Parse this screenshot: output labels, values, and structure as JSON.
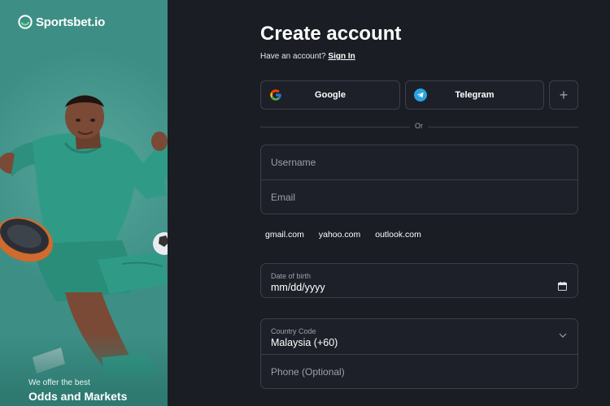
{
  "brand": {
    "name": "Sportsbet.io"
  },
  "promo": {
    "tagline_small": "We offer the best",
    "tagline_big": "Odds and Markets"
  },
  "form": {
    "title": "Create account",
    "have_account_text": "Have an account?",
    "sign_in_link": "Sign In",
    "social": {
      "google_label": "Google",
      "telegram_label": "Telegram",
      "more_label": "+"
    },
    "divider_text": "Or",
    "username_placeholder": "Username",
    "email_placeholder": "Email",
    "email_domains": [
      "gmail.com",
      "yahoo.com",
      "outlook.com"
    ],
    "dob": {
      "label": "Date of birth",
      "value": "mm/dd/yyyy",
      "icon": "calendar-icon"
    },
    "country": {
      "label": "Country Code",
      "value": "Malaysia (+60)",
      "icon": "chevron-down-icon"
    },
    "phone_placeholder": "Phone (Optional)"
  },
  "colors": {
    "promo_bg": "#3d8f86",
    "page_bg": "#1a1d24",
    "field_border": "#3a3f49",
    "muted_text": "#9aa0aa",
    "brand_green": "#6fe08c",
    "telegram_blue": "#2aa3e0"
  }
}
